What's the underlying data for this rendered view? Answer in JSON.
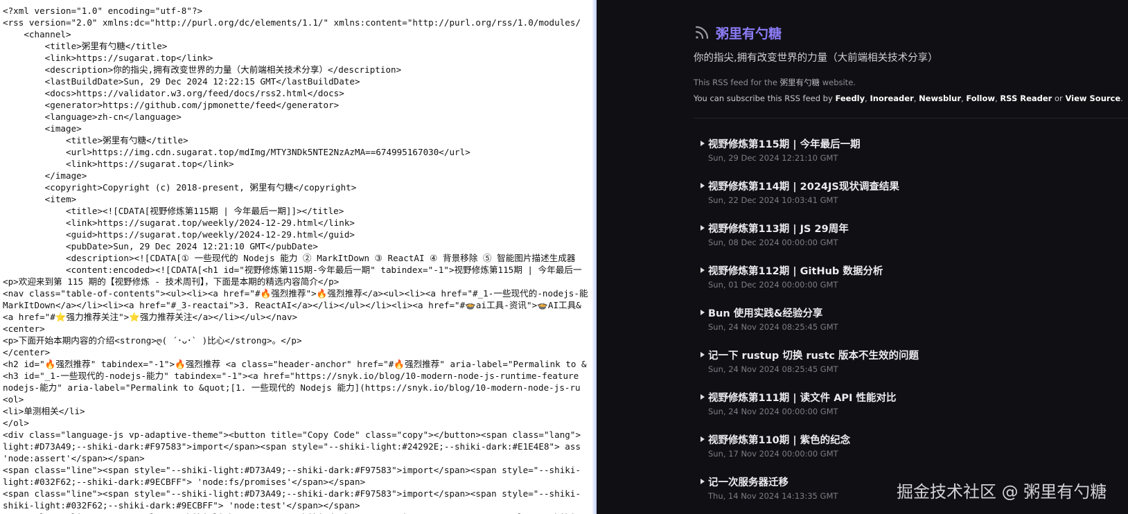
{
  "source": {
    "lines": [
      "<?xml version=\"1.0\" encoding=\"utf-8\"?>",
      "<rss version=\"2.0\" xmlns:dc=\"http://purl.org/dc/elements/1.1/\" xmlns:content=\"http://purl.org/rss/1.0/modules/",
      "    <channel>",
      "        <title>粥里有勺糖</title>",
      "        <link>https://sugarat.top</link>",
      "        <description>你的指尖,拥有改变世界的力量（大前端相关技术分享）</description>",
      "        <lastBuildDate>Sun, 29 Dec 2024 12:22:15 GMT</lastBuildDate>",
      "        <docs>https://validator.w3.org/feed/docs/rss2.html</docs>",
      "        <generator>https://github.com/jpmonette/feed</generator>",
      "        <language>zh-cn</language>",
      "        <image>",
      "            <title>粥里有勺糖</title>",
      "            <url>https://img.cdn.sugarat.top/mdImg/MTY3NDk5NTE2NzAzMA==674995167030</url>",
      "            <link>https://sugarat.top</link>",
      "        </image>",
      "        <copyright>Copyright (c) 2018-present, 粥里有勺糖</copyright>",
      "        <item>",
      "            <title><![CDATA[视野修炼第115期 | 今年最后一期]]></title>",
      "            <link>https://sugarat.top/weekly/2024-12-29.html</link>",
      "            <guid>https://sugarat.top/weekly/2024-12-29.html</guid>",
      "            <pubDate>Sun, 29 Dec 2024 12:21:10 GMT</pubDate>",
      "            <description><![CDATA[① 一些现代的 Nodejs 能力 ② MarkItDown ③ ReactAI ④ 背景移除 ⑤ 智能图片描述生成器",
      "            <content:encoded><![CDATA[<h1 id=\"视野修炼第115期-今年最后一期\" tabindex=\"-1\">视野修炼第115期 | 今年最后一",
      "<p>欢迎来到第 115 期的【视野修炼 - 技术周刊】，下面是本期的精选内容简介</p>",
      "<nav class=\"table-of-contents\"><ul><li><a href=\"#🔥强烈推荐\">🔥强烈推荐</a><ul><li><a href=\"#_1-一些现代的-nodejs-能",
      "MarkItDown</a></li><li><a href=\"#_3-reactai\">3. ReactAI</a></li></ul></li><li><a href=\"#🍲ai工具-资讯\">🍲AI工具&",
      "<a href=\"#⭐强力推荐关注\">⭐强力推荐关注</a></li></ul></nav>",
      "<center>",
      "<p>下面开始本期内容的介绍<strong>ღ( ´･ᴗ･` )比心</strong>。</p>",
      "</center>",
      "<h2 id=\"🔥强烈推荐\" tabindex=\"-1\">🔥强烈推荐 <a class=\"header-anchor\" href=\"#🔥强烈推荐\" aria-label=\"Permalink to &",
      "<h3 id=\"_1-一些现代的-nodejs-能力\" tabindex=\"-1\"><a href=\"https://snyk.io/blog/10-modern-node-js-runtime-feature",
      "nodejs-能力\" aria-label=\"Permalink to &quot;[1. 一些现代的 Nodejs 能力](https://snyk.io/blog/10-modern-node-js-ru",
      "<ol>",
      "<li>单测相关</li>",
      "</ol>",
      "<div class=\"language-js vp-adaptive-theme\"><button title=\"Copy Code\" class=\"copy\"></button><span class=\"lang\">",
      "light:#D73A49;--shiki-dark:#F97583\">import</span><span style=\"--shiki-light:#24292E;--shiki-dark:#E1E4E8\"> ass",
      "'node:assert'</span></span>",
      "<span class=\"line\"><span style=\"--shiki-light:#D73A49;--shiki-dark:#F97583\">import</span><span style=\"--shiki-",
      "light:#032F62;--shiki-dark:#9ECBFF\"> 'node:fs/promises'</span></span>",
      "<span class=\"line\"><span style=\"--shiki-light:#D73A49;--shiki-dark:#F97583\">import</span><span style=\"--shiki-",
      "shiki-light:#032F62;--shiki-dark:#9ECBFF\"> 'node:test'</span></span>",
      "<span class=\"line\"><span style=\"--shiki-light:#D73A49;--shiki-dark:#F97583\">import</span><span style=\"--shiki-",
      "light:#032F62;--shiki-dark:#9ECBFF\"> '../src/math.js'</span></span>"
    ]
  },
  "preview": {
    "feed_title": "粥里有勺糖",
    "feed_description": "你的指尖,拥有改变世界的力量（大前端相关技术分享）",
    "note_prefix": "This RSS feed for the ",
    "note_site": "粥里有勺糖",
    "note_suffix": " website.",
    "subscribe_prefix": "You can subscribe this RSS feed by ",
    "links": {
      "feedly": "Feedly",
      "inoreader": "Inoreader",
      "newsblur": "Newsblur",
      "follow": "Follow",
      "rss_reader": "RSS Reader",
      "view_source": "View Source"
    },
    "sep_comma": ", ",
    "sep_or": " or ",
    "period": ".",
    "items": [
      {
        "title": "视野修炼第115期 | 今年最后一期",
        "date": "Sun, 29 Dec 2024 12:21:10 GMT"
      },
      {
        "title": "视野修炼第114期 | 2024JS现状调查结果",
        "date": "Sun, 22 Dec 2024 10:03:41 GMT"
      },
      {
        "title": "视野修炼第113期 | JS 29周年",
        "date": "Sun, 08 Dec 2024 00:00:00 GMT"
      },
      {
        "title": "视野修炼第112期 | GitHub 数据分析",
        "date": "Sun, 01 Dec 2024 00:00:00 GMT"
      },
      {
        "title": "Bun 使用实践&经验分享",
        "date": "Sun, 24 Nov 2024 08:25:45 GMT"
      },
      {
        "title": "记一下 rustup 切换 rustc 版本不生效的问题",
        "date": "Sun, 24 Nov 2024 08:25:45 GMT"
      },
      {
        "title": "视野修炼第111期 | 读文件 API 性能对比",
        "date": "Sun, 24 Nov 2024 00:00:00 GMT"
      },
      {
        "title": "视野修炼第110期 | 紫色的纪念",
        "date": "Sun, 17 Nov 2024 00:00:00 GMT"
      },
      {
        "title": "记一次服务器迁移",
        "date": "Thu, 14 Nov 2024 14:13:35 GMT"
      }
    ],
    "icons": {
      "feed": "rss-icon",
      "expand": "triangle-right-icon"
    },
    "colors": {
      "accent": "#8b7cf6",
      "background": "#101014"
    }
  },
  "watermark": "掘金技术社区 @ 粥里有勺糖"
}
